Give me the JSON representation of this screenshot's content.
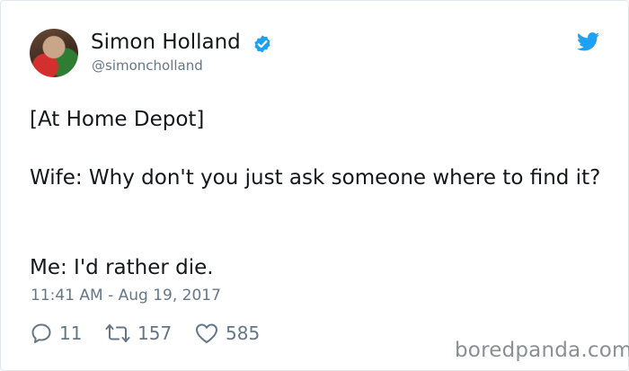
{
  "tweet": {
    "author_name": "Simon Holland",
    "author_handle": "@simoncholland",
    "text_lines": [
      "[At Home Depot]",
      "Wife: Why don't you just ask someone where to find it?",
      "Me: I'd rather die."
    ],
    "timestamp": "11:41 AM - Aug 19, 2017",
    "stats": {
      "replies": "11",
      "retweets": "157",
      "likes": "585"
    }
  },
  "icons": {
    "verified": "verified-badge-icon",
    "platform": "twitter-bird-icon",
    "reply": "reply-bubble-icon",
    "retweet": "retweet-arrows-icon",
    "like": "heart-icon"
  },
  "colors": {
    "verified_blue": "#1da1f2",
    "muted_text": "#657786",
    "body_text": "#14171a"
  },
  "watermark": "boredpanda.com"
}
